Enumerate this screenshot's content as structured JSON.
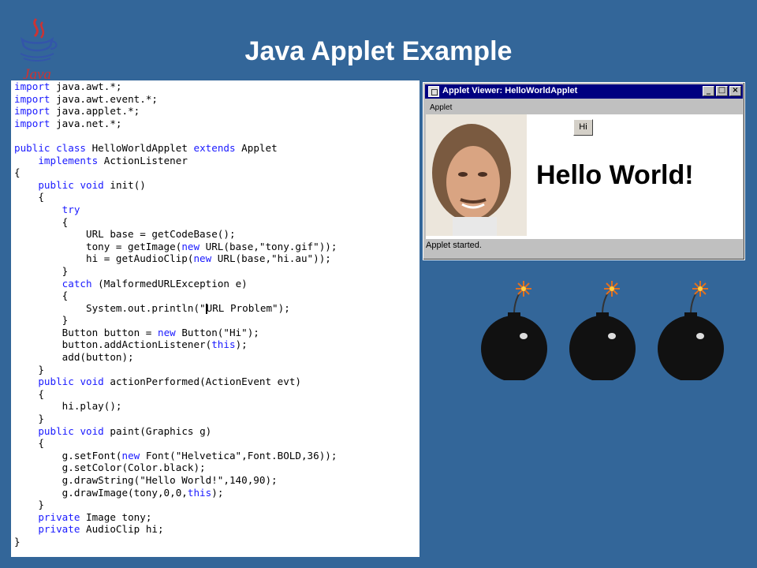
{
  "slide": {
    "title": "Java Applet Example",
    "logo_text": "Java"
  },
  "code": {
    "lines": [
      [
        [
          "kw",
          "import"
        ],
        [
          "t",
          " java.awt.*;"
        ]
      ],
      [
        [
          "kw",
          "import"
        ],
        [
          "t",
          " java.awt.event.*;"
        ]
      ],
      [
        [
          "kw",
          "import"
        ],
        [
          "t",
          " java.applet.*;"
        ]
      ],
      [
        [
          "kw",
          "import"
        ],
        [
          "t",
          " java.net.*;"
        ]
      ],
      [
        [
          "t",
          ""
        ]
      ],
      [
        [
          "kw",
          "public"
        ],
        [
          "t",
          " "
        ],
        [
          "kw",
          "class"
        ],
        [
          "t",
          " HelloWorldApplet "
        ],
        [
          "kw",
          "extends"
        ],
        [
          "t",
          " Applet"
        ]
      ],
      [
        [
          "t",
          "    "
        ],
        [
          "kw",
          "implements"
        ],
        [
          "t",
          " ActionListener"
        ]
      ],
      [
        [
          "t",
          "{"
        ]
      ],
      [
        [
          "t",
          "    "
        ],
        [
          "kw",
          "public"
        ],
        [
          "t",
          " "
        ],
        [
          "kw",
          "void"
        ],
        [
          "t",
          " init()"
        ]
      ],
      [
        [
          "t",
          "    {"
        ]
      ],
      [
        [
          "t",
          "        "
        ],
        [
          "kw",
          "try"
        ]
      ],
      [
        [
          "t",
          "        {"
        ]
      ],
      [
        [
          "t",
          "            URL base = getCodeBase();"
        ]
      ],
      [
        [
          "t",
          "            tony = getImage("
        ],
        [
          "kw",
          "new"
        ],
        [
          "t",
          " URL(base,\"tony.gif\"));"
        ]
      ],
      [
        [
          "t",
          "            hi = getAudioClip("
        ],
        [
          "kw",
          "new"
        ],
        [
          "t",
          " URL(base,\"hi.au\"));"
        ]
      ],
      [
        [
          "t",
          "        }"
        ]
      ],
      [
        [
          "t",
          "        "
        ],
        [
          "kw",
          "catch"
        ],
        [
          "t",
          " (MalformedURLException e)"
        ]
      ],
      [
        [
          "t",
          "        {"
        ]
      ],
      [
        [
          "t",
          "            System.out.println(\""
        ],
        [
          "cursor",
          ""
        ],
        [
          "t",
          "URL Problem\");"
        ]
      ],
      [
        [
          "t",
          "        }"
        ]
      ],
      [
        [
          "t",
          "        Button button = "
        ],
        [
          "kw",
          "new"
        ],
        [
          "t",
          " Button(\"Hi\");"
        ]
      ],
      [
        [
          "t",
          "        button.addActionListener("
        ],
        [
          "kw",
          "this"
        ],
        [
          "t",
          ");"
        ]
      ],
      [
        [
          "t",
          "        add(button);"
        ]
      ],
      [
        [
          "t",
          "    }"
        ]
      ],
      [
        [
          "t",
          "    "
        ],
        [
          "kw",
          "public"
        ],
        [
          "t",
          " "
        ],
        [
          "kw",
          "void"
        ],
        [
          "t",
          " actionPerformed(ActionEvent evt)"
        ]
      ],
      [
        [
          "t",
          "    {"
        ]
      ],
      [
        [
          "t",
          "        hi.play();"
        ]
      ],
      [
        [
          "t",
          "    }"
        ]
      ],
      [
        [
          "t",
          "    "
        ],
        [
          "kw",
          "public"
        ],
        [
          "t",
          " "
        ],
        [
          "kw",
          "void"
        ],
        [
          "t",
          " paint(Graphics g)"
        ]
      ],
      [
        [
          "t",
          "    {"
        ]
      ],
      [
        [
          "t",
          "        g.setFont("
        ],
        [
          "kw",
          "new"
        ],
        [
          "t",
          " Font(\"Helvetica\",Font.BOLD,36));"
        ]
      ],
      [
        [
          "t",
          "        g.setColor(Color.black);"
        ]
      ],
      [
        [
          "t",
          "        g.drawString(\"Hello World!\",140,90);"
        ]
      ],
      [
        [
          "t",
          "        g.drawImage(tony,0,0,"
        ],
        [
          "kw",
          "this"
        ],
        [
          "t",
          ");"
        ]
      ],
      [
        [
          "t",
          "    }"
        ]
      ],
      [
        [
          "t",
          "    "
        ],
        [
          "kw",
          "private"
        ],
        [
          "t",
          " Image tony;"
        ]
      ],
      [
        [
          "t",
          "    "
        ],
        [
          "kw",
          "private"
        ],
        [
          "t",
          " AudioClip hi;"
        ]
      ],
      [
        [
          "t",
          "}"
        ]
      ]
    ]
  },
  "applet_viewer": {
    "title": "Applet Viewer: HelloWorldApplet",
    "menu": "Applet",
    "button_label": "Hi",
    "hello_text": "Hello World!",
    "status": "Applet started.",
    "minimize_glyph": "_",
    "maximize_glyph": "□",
    "close_glyph": "×"
  },
  "colors": {
    "background": "#336699",
    "keyword": "#1a1aff",
    "titlebar": "#000080"
  }
}
